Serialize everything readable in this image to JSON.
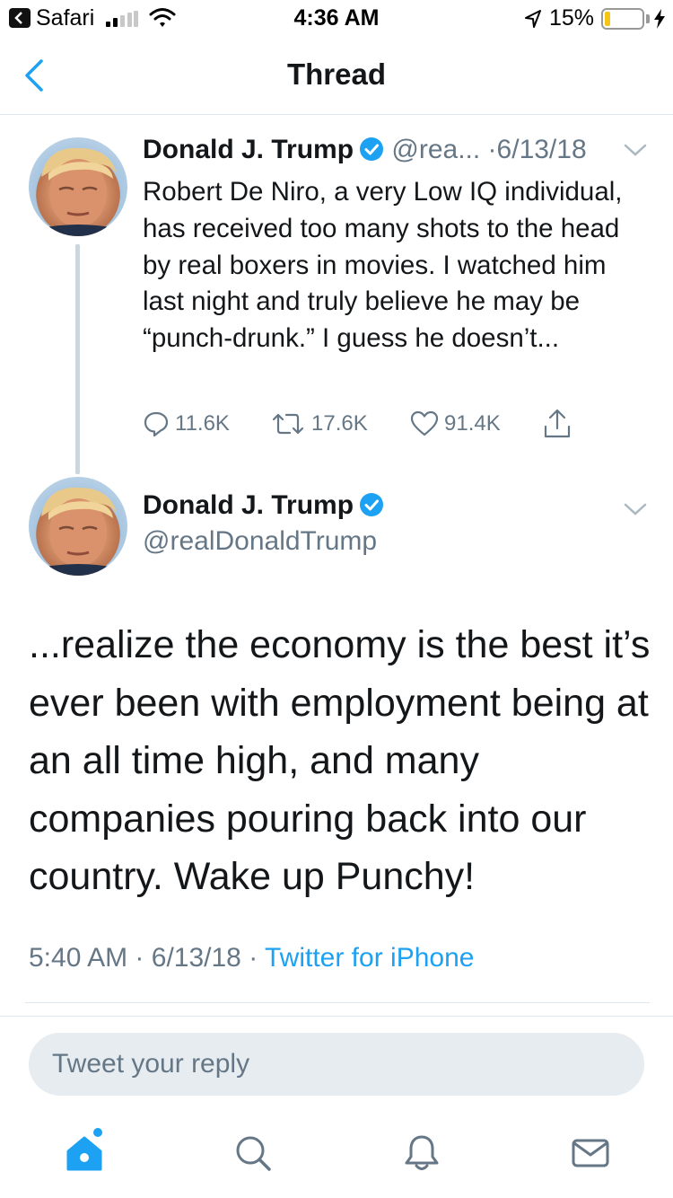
{
  "status_bar": {
    "back_app": "Safari",
    "time": "4:36 AM",
    "battery_percent": "15%",
    "battery_level": 0.15,
    "signal_bars": 2
  },
  "nav": {
    "title": "Thread",
    "back_icon": "chevron-left-icon"
  },
  "tweet1": {
    "name": "Donald J. Trump",
    "handle": "@rea...",
    "separator": "·",
    "date": "6/13/18",
    "text": "Robert De Niro, a very Low IQ individual, has received too many shots to the head by real boxers in movies. I watched him last night and truly believe he may be “punch-drunk.” I guess he doesn’t...",
    "replies": "11.6K",
    "retweets": "17.6K",
    "likes": "91.4K"
  },
  "tweet2": {
    "name": "Donald J. Trump",
    "handle": "@realDonaldTrump",
    "text": "...realize the economy is the best it’s ever been with employment being at an all time high, and many companies pouring back into our country. Wake up Punchy!",
    "time": "5:40 AM",
    "date": "6/13/18",
    "separator": "·",
    "source": "Twitter for iPhone"
  },
  "reply": {
    "placeholder": "Tweet your reply"
  },
  "tabs": [
    {
      "icon": "home-icon",
      "active": true
    },
    {
      "icon": "search-icon",
      "active": false
    },
    {
      "icon": "bell-icon",
      "active": false
    },
    {
      "icon": "mail-icon",
      "active": false
    }
  ],
  "colors": {
    "accent": "#1da1f2",
    "secondary_text": "#657786",
    "primary_text": "#14171a",
    "battery_fill": "#f5c518"
  }
}
